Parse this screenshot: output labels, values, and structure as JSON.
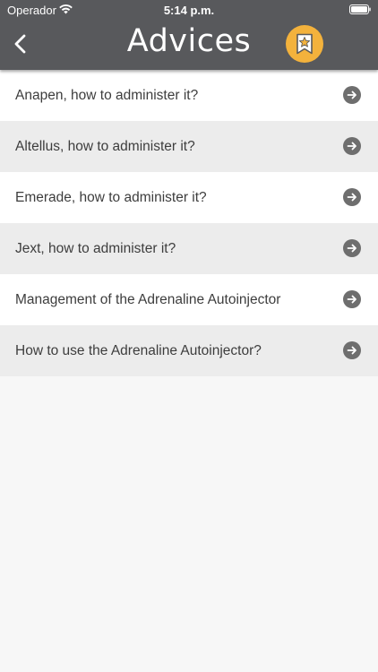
{
  "status_bar": {
    "carrier": "Operador",
    "time": "5:14 p.m."
  },
  "header": {
    "title": "Advices",
    "back_icon": "chevron-left-icon",
    "favorites_icon": "bookmark-star-icon",
    "bar_color": "#58595c",
    "favorites_color": "#f3b23c"
  },
  "advices": {
    "items": [
      {
        "label": "Anapen, how to administer it?",
        "icon": "arrow-right-circle-icon"
      },
      {
        "label": "Altellus, how to administer it?",
        "icon": "arrow-right-circle-icon"
      },
      {
        "label": "Emerade, how to administer it?",
        "icon": "arrow-right-circle-icon"
      },
      {
        "label": "Jext, how to administer it?",
        "icon": "arrow-right-circle-icon"
      },
      {
        "label": "Management of the Adrenaline Autoinjector",
        "icon": "arrow-right-circle-icon"
      },
      {
        "label": "How to use the Adrenaline Autoinjector?",
        "icon": "arrow-right-circle-icon"
      }
    ]
  }
}
